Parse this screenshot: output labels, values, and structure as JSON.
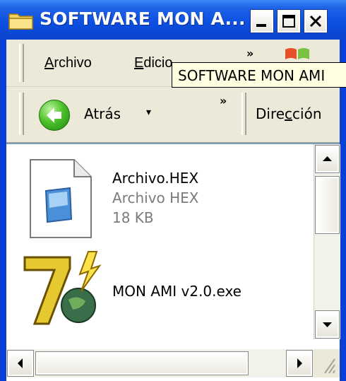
{
  "window": {
    "title": "SOFTWARE MON A...",
    "controls": {
      "minimize": "_",
      "maximize": "□",
      "close": "×"
    }
  },
  "menubar": {
    "items": [
      {
        "label_first": "A",
        "label_rest": "rchivo"
      },
      {
        "label_first": "E",
        "label_rest": "dicio"
      }
    ],
    "chevron": "»"
  },
  "tooltip": {
    "text": "SOFTWARE MON AMI"
  },
  "toolbar": {
    "back_label": "Atrás",
    "dropdown": "▾",
    "chevron": "»",
    "address_pre": "Dire",
    "address_u": "c",
    "address_post": "ción"
  },
  "files": [
    {
      "name": "Archivo.HEX",
      "type": "Archivo HEX",
      "size": "18 KB",
      "icon": "hex-document-icon"
    },
    {
      "name": "MON AMI v2.0.exe",
      "icon": "exe-app-icon"
    }
  ],
  "colors": {
    "titlebar": "#0a4ee0",
    "tooltip_bg": "#ffffe1",
    "window_bg": "#ece9d8"
  }
}
